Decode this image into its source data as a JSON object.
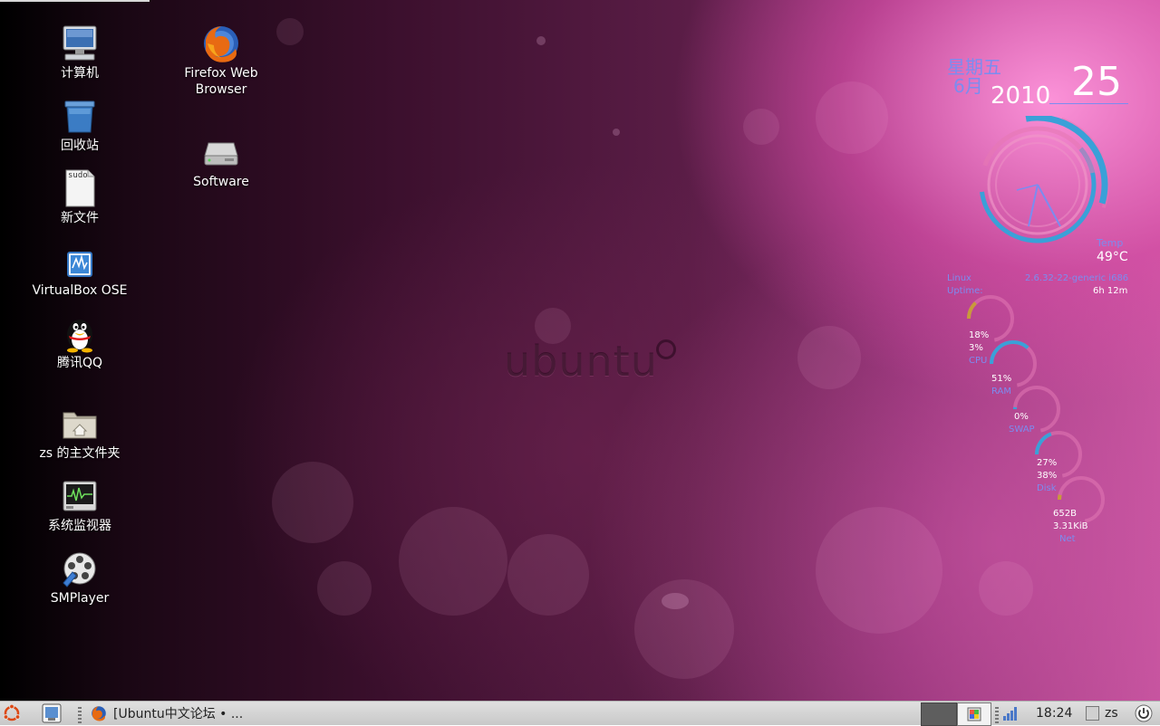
{
  "desktop_icons": {
    "computer": "计算机",
    "trash": "回收站",
    "new_file": "新文件",
    "new_file_tag": "sudo",
    "virtualbox": "VirtualBox OSE",
    "qq": "腾讯QQ",
    "home_folder": "zs 的主文件夹",
    "system_monitor": "系统监视器",
    "smplayer": "SMPlayer",
    "firefox_line1": "Firefox Web",
    "firefox_line2": "Browser",
    "software": "Software"
  },
  "wallpaper": {
    "logo_text": "ubuntu"
  },
  "conky": {
    "weekday": "星期五",
    "month": "6月",
    "year": "2010",
    "day": "25",
    "temp_label": "Temp",
    "temperature": "49°C",
    "os_label": "Linux",
    "kernel": "2.6.32-22-generic i686",
    "uptime_label": "Uptime:",
    "uptime": "6h 12m",
    "cpu_val1": "18%",
    "cpu_val2": "3%",
    "cpu_label": "CPU",
    "ram_val": "51%",
    "ram_label": "RAM",
    "swap_val": "0%",
    "swap_label": "SWAP",
    "disk_val1": "27%",
    "disk_val2": "38%",
    "disk_label": "Disk",
    "net_val1": "652B",
    "net_val2": "3.31KiB",
    "net_label": "Net",
    "rings": {
      "cpu": 0.18,
      "ram": 0.51,
      "swap": 0.0,
      "disk": 0.27,
      "net": 0.05
    }
  },
  "taskbar": {
    "window_title": "[Ubuntu中文论坛 • ...",
    "clock": "18:24",
    "user": "zs"
  },
  "colors": {
    "conky_purple": "#7b8cf0",
    "ring_blue": "#3aa0d8",
    "ring_pink": "#e07ab0",
    "ring_gold": "#c89a3a"
  }
}
